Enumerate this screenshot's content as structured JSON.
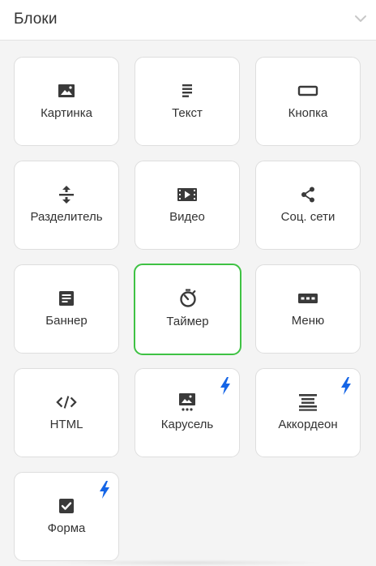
{
  "panel": {
    "title": "Блоки",
    "collapse_icon": "chevron-down-icon"
  },
  "colors": {
    "selected_border": "#3fc244",
    "bolt": "#1565e6",
    "icon": "#3a3a3a"
  },
  "blocks": [
    {
      "label": "Картинка",
      "icon": "image-icon",
      "premium": false,
      "selected": false
    },
    {
      "label": "Текст",
      "icon": "text-lines-icon",
      "premium": false,
      "selected": false
    },
    {
      "label": "Кнопка",
      "icon": "button-icon",
      "premium": false,
      "selected": false
    },
    {
      "label": "Разделитель",
      "icon": "divider-icon",
      "premium": false,
      "selected": false
    },
    {
      "label": "Видео",
      "icon": "video-icon",
      "premium": false,
      "selected": false
    },
    {
      "label": "Соц. сети",
      "icon": "share-icon",
      "premium": false,
      "selected": false
    },
    {
      "label": "Баннер",
      "icon": "banner-icon",
      "premium": false,
      "selected": false
    },
    {
      "label": "Таймер",
      "icon": "timer-icon",
      "premium": false,
      "selected": true
    },
    {
      "label": "Меню",
      "icon": "menu-icon",
      "premium": false,
      "selected": false
    },
    {
      "label": "HTML",
      "icon": "code-icon",
      "premium": false,
      "selected": false
    },
    {
      "label": "Карусель",
      "icon": "carousel-icon",
      "premium": true,
      "selected": false
    },
    {
      "label": "Аккордеон",
      "icon": "accordion-icon",
      "premium": true,
      "selected": false
    },
    {
      "label": "Форма",
      "icon": "form-checkbox-icon",
      "premium": true,
      "selected": false
    }
  ]
}
